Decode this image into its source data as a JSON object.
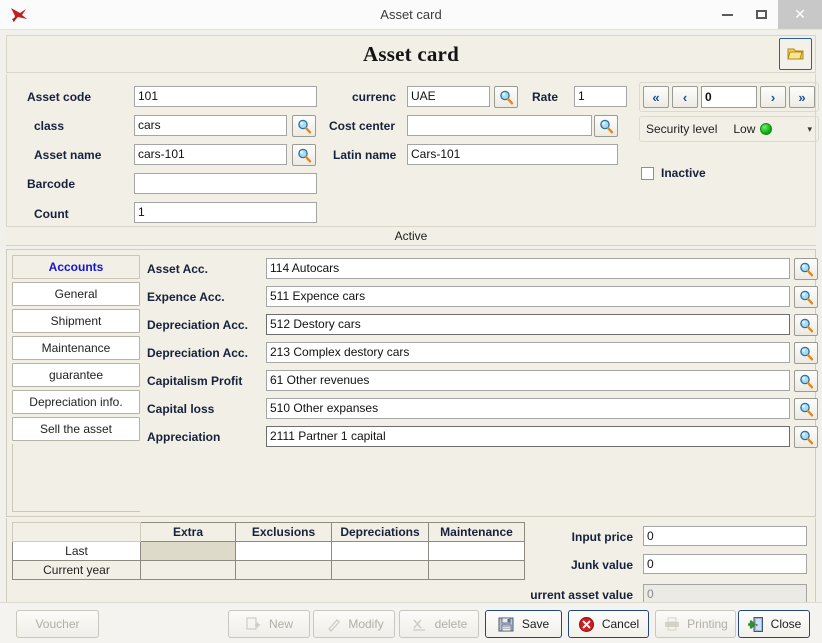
{
  "window": {
    "title": "Asset card",
    "app_icon": "falcon-logo-icon",
    "minimize": "minimize-icon",
    "maximize": "maximize-icon",
    "close": "✕"
  },
  "header": {
    "title": "Asset card",
    "folder_button_icon": "folder-icon"
  },
  "top_form": {
    "fields": [
      {
        "label": "Asset code",
        "value": "101",
        "has_lookup": false
      },
      {
        "label": "class",
        "value": "cars",
        "has_lookup": true
      },
      {
        "label": "Asset name",
        "value": "cars-101",
        "has_lookup": true
      },
      {
        "label": "Barcode",
        "value": "",
        "has_lookup": false
      },
      {
        "label": "Count",
        "value": "1",
        "has_lookup": false
      }
    ],
    "currency_label": "currenc",
    "currency_value": "UAE",
    "rate_label": "Rate",
    "rate_value": "1",
    "cost_center_label": "Cost center",
    "cost_center_value": "",
    "latin_name_label": "Latin name",
    "latin_name_value": "Cars-101"
  },
  "navigator": {
    "first": "«",
    "prev": "‹",
    "value": "0",
    "next": "›",
    "last": "»"
  },
  "security": {
    "label": "Security level",
    "value": "Low",
    "indicator_color": "#0aa60a",
    "caret": "▾"
  },
  "inactive": {
    "label": "Inactive",
    "checked": false
  },
  "active_band": {
    "label": "Active"
  },
  "tabs": [
    {
      "label": "Accounts",
      "active": true
    },
    {
      "label": "General",
      "active": false
    },
    {
      "label": "Shipment",
      "active": false
    },
    {
      "label": "Maintenance",
      "active": false
    },
    {
      "label": "guarantee",
      "active": false
    },
    {
      "label": "Depreciation info.",
      "active": false
    },
    {
      "label": "Sell the asset",
      "active": false
    }
  ],
  "accounts": [
    {
      "label": "Asset Acc.",
      "value": "114 Autocars"
    },
    {
      "label": "Expence Acc.",
      "value": "511 Expence cars"
    },
    {
      "label": "Depreciation Acc.",
      "value": "512 Destory cars"
    },
    {
      "label": "Depreciation Acc.",
      "value": "213 Complex destory cars"
    },
    {
      "label": "Capitalism Profit",
      "value": "61 Other revenues"
    },
    {
      "label": "Capital loss",
      "value": "510 Other expanses"
    },
    {
      "label": "Appreciation",
      "value": "2111 Partner  1 capital"
    }
  ],
  "grid": {
    "corner": "",
    "columns": [
      "Extra",
      "Exclusions",
      "Depreciations",
      "Maintenance"
    ],
    "rows": [
      {
        "header": "Last",
        "cells": [
          "",
          "",
          "",
          ""
        ]
      },
      {
        "header": "Current year",
        "cells": [
          "",
          "",
          "",
          ""
        ]
      }
    ]
  },
  "values": {
    "input_price_label": "Input price",
    "input_price_value": "0",
    "junk_value_label": "Junk value",
    "junk_value_value": "0",
    "current_asset_value_label": "urrent asset value",
    "current_asset_value_value": "0"
  },
  "toolbar": {
    "voucher": "Voucher",
    "new": "New",
    "modify": "Modify",
    "delete": "delete",
    "save": "Save",
    "cancel": "Cancel",
    "printing": "Printing",
    "close": "Close"
  }
}
